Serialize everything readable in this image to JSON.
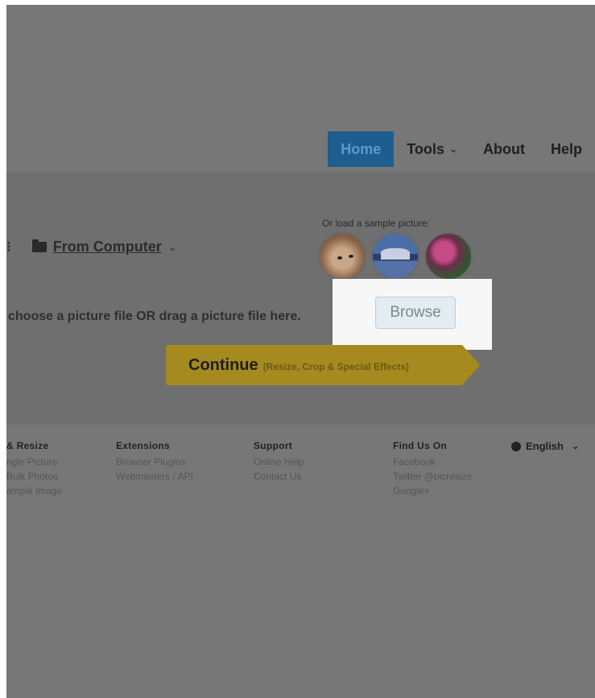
{
  "nav": {
    "home": "Home",
    "tools": "Tools",
    "about": "About",
    "help": "Help"
  },
  "source": {
    "dots": "⁝",
    "label": "From Computer",
    "caret": "⌄"
  },
  "samples": {
    "label": "Or load a sample picture:"
  },
  "drop": {
    "text": "choose a picture file OR drag a picture file here.",
    "browse": "Browse"
  },
  "continue": {
    "label": "Continue",
    "sub": "(Resize, Crop & Special Effects)"
  },
  "footer": {
    "col1": {
      "title": "& Resize",
      "links": [
        "ngle Picture",
        "Bulk Photos",
        "ample Image"
      ]
    },
    "col2": {
      "title": "Extensions",
      "links": [
        "Browser Plugins",
        "Webmasters / API"
      ]
    },
    "col3": {
      "title": "Support",
      "links": [
        "Online Help",
        "Contact Us"
      ]
    },
    "col4": {
      "title": "Find Us On",
      "links": [
        "Facebook",
        "Twitter @picresize",
        "Google+"
      ]
    },
    "language": "English"
  },
  "colors": {
    "overlay": "#777777",
    "nav_active": "#1d5e8e",
    "continue": "#a58a1f"
  }
}
